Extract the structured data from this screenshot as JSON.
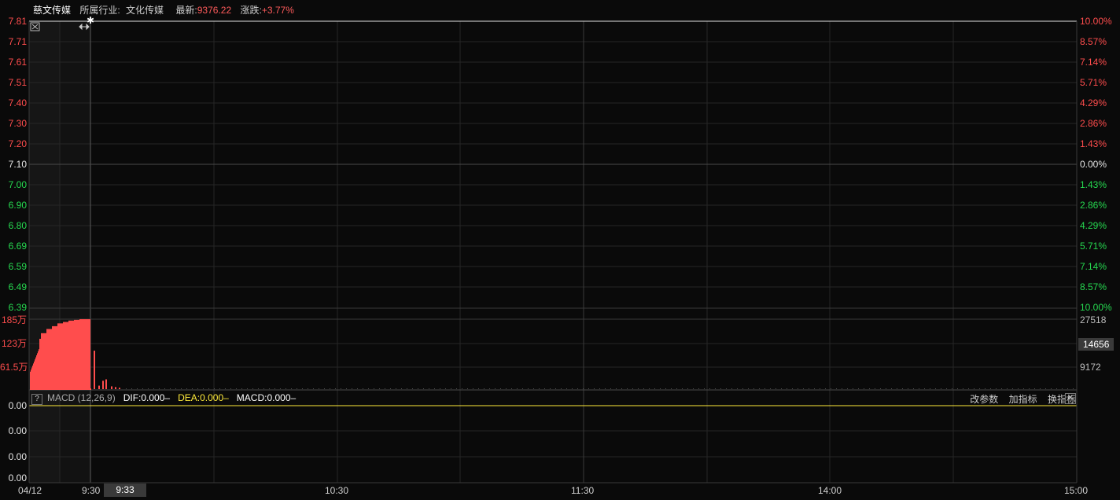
{
  "header": {
    "stock_name": "慈文传媒",
    "industry_label": "所属行业:",
    "industry_value": "文化传媒",
    "latest_label": "最新:",
    "latest_value": "9376.22",
    "change_label": "涨跌:",
    "change_value": "+3.77%"
  },
  "price_axis": {
    "left": [
      "7.81",
      "7.71",
      "7.61",
      "7.51",
      "7.40",
      "7.30",
      "7.20",
      "7.10",
      "7.00",
      "6.90",
      "6.80",
      "6.69",
      "6.59",
      "6.49",
      "6.39"
    ],
    "right": [
      "10.00%",
      "8.57%",
      "7.14%",
      "5.71%",
      "4.29%",
      "2.86%",
      "1.43%",
      "0.00%",
      "1.43%",
      "2.86%",
      "4.29%",
      "5.71%",
      "7.14%",
      "8.57%",
      "10.00%"
    ]
  },
  "volume_axis": {
    "left": [
      "185万",
      "123万",
      "61.5万"
    ],
    "right": [
      "27518",
      "9172"
    ],
    "right_highlight": "14656"
  },
  "macd_panel": {
    "help": "?",
    "name": "MACD (12,26,9)",
    "dif": "DIF:0.000–",
    "dea": "DEA:0.000–",
    "macd": "MACD:0.000–",
    "btn_params": "改参数",
    "btn_add": "加指标",
    "btn_switch": "换指标",
    "close": "✕",
    "axis": [
      "0.00",
      "0.00",
      "0.00",
      "0.00"
    ]
  },
  "time_axis": {
    "date": "04/12",
    "t0930": "9:30",
    "cursor": "9:33",
    "t1030": "10:30",
    "t1130": "11:30",
    "t1400": "14:00",
    "t1500": "15:00"
  },
  "colors": {
    "up": "#ff4d4d",
    "down": "#26d950",
    "dea_line": "#ffeb3b",
    "grid": "#262626",
    "background": "#0a0a0a"
  },
  "volume_bars": {
    "opening_auction_fill": [
      0.6,
      0.72,
      0.8,
      0.86,
      0.9,
      0.94,
      0.96,
      0.98,
      0.99,
      1.0,
      1.0
    ],
    "post_open": [
      0.55,
      0.05,
      0.12,
      0.14,
      0.04,
      0.03,
      0.02
    ]
  },
  "icons": {
    "close_chart": "close-icon",
    "resize": "resize-horizontal-icon",
    "cursor_marker": "asterisk-icon"
  }
}
